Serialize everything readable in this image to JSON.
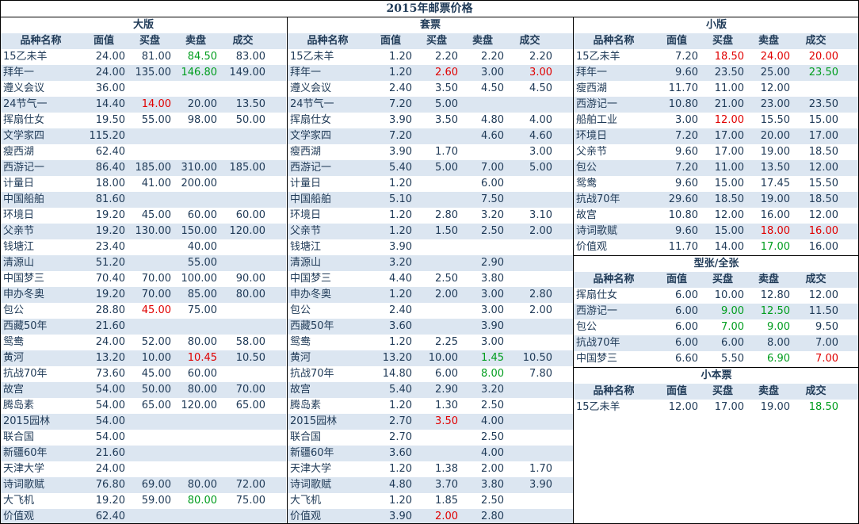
{
  "title": "2015年邮票价格",
  "headers": [
    "品种名称",
    "面值",
    "买盘",
    "卖盘",
    "成交"
  ],
  "colors": {
    "red": "#e00000",
    "green": "#009d1e",
    "shade": "#dce6f1",
    "text": "#1f3a57"
  },
  "sections": [
    {
      "id": "large",
      "title": "大版",
      "rows": [
        {
          "name": "15乙未羊",
          "face": "24.00",
          "bid": "81.00",
          "ask": "84.50",
          "deal": "83.00",
          "colors": {
            "ask": "green"
          }
        },
        {
          "name": "拜年一",
          "face": "24.00",
          "bid": "135.00",
          "ask": "146.80",
          "deal": "149.00",
          "colors": {
            "ask": "green"
          }
        },
        {
          "name": "遵义会议",
          "face": "36.00",
          "bid": "",
          "ask": "",
          "deal": ""
        },
        {
          "name": "24节气一",
          "face": "14.40",
          "bid": "14.00",
          "ask": "20.00",
          "deal": "13.50",
          "colors": {
            "bid": "red"
          }
        },
        {
          "name": "挥扇仕女",
          "face": "19.50",
          "bid": "55.00",
          "ask": "98.00",
          "deal": "50.00"
        },
        {
          "name": "文学家四",
          "face": "115.20",
          "bid": "",
          "ask": "",
          "deal": ""
        },
        {
          "name": "瘦西湖",
          "face": "62.40",
          "bid": "",
          "ask": "",
          "deal": ""
        },
        {
          "name": "西游记一",
          "face": "86.40",
          "bid": "185.00",
          "ask": "310.00",
          "deal": "185.00"
        },
        {
          "name": "计量日",
          "face": "18.00",
          "bid": "41.00",
          "ask": "200.00",
          "deal": ""
        },
        {
          "name": "中国船舶",
          "face": "81.60",
          "bid": "",
          "ask": "",
          "deal": ""
        },
        {
          "name": "环境日",
          "face": "19.20",
          "bid": "45.00",
          "ask": "60.00",
          "deal": "60.00"
        },
        {
          "name": "父亲节",
          "face": "19.20",
          "bid": "130.00",
          "ask": "150.00",
          "deal": "120.00"
        },
        {
          "name": "钱塘江",
          "face": "23.40",
          "bid": "",
          "ask": "40.00",
          "deal": ""
        },
        {
          "name": "清源山",
          "face": "51.20",
          "bid": "",
          "ask": "55.00",
          "deal": ""
        },
        {
          "name": "中国梦三",
          "face": "70.40",
          "bid": "70.00",
          "ask": "100.00",
          "deal": "90.00"
        },
        {
          "name": "申办冬奥",
          "face": "19.20",
          "bid": "70.00",
          "ask": "85.00",
          "deal": "80.00"
        },
        {
          "name": "包公",
          "face": "28.80",
          "bid": "45.00",
          "ask": "75.00",
          "deal": "",
          "colors": {
            "bid": "red"
          }
        },
        {
          "name": "西藏50年",
          "face": "21.60",
          "bid": "",
          "ask": "",
          "deal": ""
        },
        {
          "name": "鸳鸯",
          "face": "24.00",
          "bid": "52.00",
          "ask": "80.00",
          "deal": "58.00"
        },
        {
          "name": "黄河",
          "face": "13.20",
          "bid": "10.00",
          "ask": "10.45",
          "deal": "10.50",
          "colors": {
            "ask": "red"
          }
        },
        {
          "name": "抗战70年",
          "face": "73.60",
          "bid": "45.00",
          "ask": "60.00",
          "deal": ""
        },
        {
          "name": "故宫",
          "face": "54.00",
          "bid": "50.00",
          "ask": "80.00",
          "deal": "70.00"
        },
        {
          "name": "腾岛素",
          "face": "54.00",
          "bid": "65.00",
          "ask": "120.00",
          "deal": "65.00"
        },
        {
          "name": "2015园林",
          "face": "54.00",
          "bid": "",
          "ask": "",
          "deal": ""
        },
        {
          "name": "联合国",
          "face": "54.00",
          "bid": "",
          "ask": "",
          "deal": ""
        },
        {
          "name": "新疆60年",
          "face": "21.60",
          "bid": "",
          "ask": "",
          "deal": ""
        },
        {
          "name": "天津大学",
          "face": "24.00",
          "bid": "",
          "ask": "",
          "deal": ""
        },
        {
          "name": "诗词歌赋",
          "face": "76.80",
          "bid": "69.00",
          "ask": "80.00",
          "deal": "72.00"
        },
        {
          "name": "大飞机",
          "face": "19.20",
          "bid": "59.00",
          "ask": "80.00",
          "deal": "75.00",
          "colors": {
            "ask": "green"
          }
        },
        {
          "name": "价值观",
          "face": "62.40",
          "bid": "",
          "ask": "",
          "deal": ""
        }
      ]
    },
    {
      "id": "set",
      "title": "套票",
      "rows": [
        {
          "name": "15乙未羊",
          "face": "1.20",
          "bid": "2.20",
          "ask": "2.20",
          "deal": "2.20"
        },
        {
          "name": "拜年一",
          "face": "1.20",
          "bid": "2.60",
          "ask": "3.00",
          "deal": "3.00",
          "colors": {
            "bid": "red",
            "deal": "red"
          }
        },
        {
          "name": "遵义会议",
          "face": "2.40",
          "bid": "3.50",
          "ask": "4.50",
          "deal": "4.50"
        },
        {
          "name": "24节气一",
          "face": "7.20",
          "bid": "5.00",
          "ask": "",
          "deal": ""
        },
        {
          "name": "挥扇仕女",
          "face": "3.90",
          "bid": "3.50",
          "ask": "4.80",
          "deal": "4.00"
        },
        {
          "name": "文学家四",
          "face": "7.20",
          "bid": "",
          "ask": "4.60",
          "deal": "4.60"
        },
        {
          "name": "瘦西湖",
          "face": "3.90",
          "bid": "1.70",
          "ask": "",
          "deal": "3.00"
        },
        {
          "name": "西游记一",
          "face": "5.40",
          "bid": "5.00",
          "ask": "7.00",
          "deal": "5.00"
        },
        {
          "name": "计量日",
          "face": "1.20",
          "bid": "",
          "ask": "6.00",
          "deal": ""
        },
        {
          "name": "中国船舶",
          "face": "5.10",
          "bid": "",
          "ask": "7.50",
          "deal": ""
        },
        {
          "name": "环境日",
          "face": "1.20",
          "bid": "2.80",
          "ask": "3.20",
          "deal": "3.10"
        },
        {
          "name": "父亲节",
          "face": "1.20",
          "bid": "1.50",
          "ask": "2.50",
          "deal": "2.00"
        },
        {
          "name": "钱塘江",
          "face": "3.90",
          "bid": "",
          "ask": "",
          "deal": ""
        },
        {
          "name": "清源山",
          "face": "3.20",
          "bid": "",
          "ask": "2.90",
          "deal": ""
        },
        {
          "name": "中国梦三",
          "face": "4.40",
          "bid": "2.50",
          "ask": "3.80",
          "deal": ""
        },
        {
          "name": "申办冬奥",
          "face": "1.20",
          "bid": "2.00",
          "ask": "3.00",
          "deal": "2.80"
        },
        {
          "name": "包公",
          "face": "2.40",
          "bid": "",
          "ask": "3.00",
          "deal": "2.00"
        },
        {
          "name": "西藏50年",
          "face": "3.60",
          "bid": "",
          "ask": "3.90",
          "deal": ""
        },
        {
          "name": "鸳鸯",
          "face": "1.20",
          "bid": "2.25",
          "ask": "3.00",
          "deal": ""
        },
        {
          "name": "黄河",
          "face": "13.20",
          "bid": "10.00",
          "ask": "1.45",
          "deal": "10.50",
          "colors": {
            "ask": "green"
          }
        },
        {
          "name": "抗战70年",
          "face": "14.80",
          "bid": "6.00",
          "ask": "8.00",
          "deal": "7.80",
          "colors": {
            "ask": "green"
          }
        },
        {
          "name": "故宫",
          "face": "5.40",
          "bid": "2.90",
          "ask": "3.20",
          "deal": ""
        },
        {
          "name": "腾岛素",
          "face": "1.20",
          "bid": "1.30",
          "ask": "2.50",
          "deal": ""
        },
        {
          "name": "2015园林",
          "face": "2.70",
          "bid": "3.50",
          "ask": "4.00",
          "deal": "",
          "colors": {
            "bid": "red"
          }
        },
        {
          "name": "联合国",
          "face": "2.70",
          "bid": "",
          "ask": "2.50",
          "deal": ""
        },
        {
          "name": "新疆60年",
          "face": "3.60",
          "bid": "",
          "ask": "4.00",
          "deal": ""
        },
        {
          "name": "天津大学",
          "face": "1.20",
          "bid": "1.38",
          "ask": "2.00",
          "deal": "1.70"
        },
        {
          "name": "诗词歌赋",
          "face": "4.80",
          "bid": "3.70",
          "ask": "3.80",
          "deal": "3.90"
        },
        {
          "name": "大飞机",
          "face": "1.20",
          "bid": "1.85",
          "ask": "2.50",
          "deal": ""
        },
        {
          "name": "价值观",
          "face": "3.90",
          "bid": "2.00",
          "ask": "2.80",
          "deal": "",
          "colors": {
            "bid": "red"
          }
        }
      ]
    },
    {
      "id": "small",
      "title": "小版",
      "rows": [
        {
          "name": "15乙未羊",
          "face": "7.20",
          "bid": "18.50",
          "ask": "24.00",
          "deal": "20.00",
          "colors": {
            "bid": "red",
            "ask": "red",
            "deal": "red"
          }
        },
        {
          "name": "拜年一",
          "face": "9.60",
          "bid": "23.50",
          "ask": "25.00",
          "deal": "23.50",
          "colors": {
            "deal": "green"
          }
        },
        {
          "name": "瘦西湖",
          "face": "11.70",
          "bid": "11.00",
          "ask": "12.00",
          "deal": ""
        },
        {
          "name": "西游记一",
          "face": "10.80",
          "bid": "21.00",
          "ask": "23.00",
          "deal": "23.50"
        },
        {
          "name": "船舶工业",
          "face": "3.00",
          "bid": "12.00",
          "ask": "15.50",
          "deal": "15.00",
          "colors": {
            "bid": "red"
          }
        },
        {
          "name": "环境日",
          "face": "7.20",
          "bid": "17.00",
          "ask": "20.00",
          "deal": "17.00"
        },
        {
          "name": "父亲节",
          "face": "9.60",
          "bid": "17.00",
          "ask": "19.00",
          "deal": "18.50"
        },
        {
          "name": "包公",
          "face": "7.20",
          "bid": "11.00",
          "ask": "13.50",
          "deal": "12.00"
        },
        {
          "name": "鸳鸯",
          "face": "9.60",
          "bid": "15.00",
          "ask": "17.45",
          "deal": "15.50"
        },
        {
          "name": "抗战70年",
          "face": "29.60",
          "bid": "18.50",
          "ask": "19.00",
          "deal": "18.50"
        },
        {
          "name": "故宫",
          "face": "10.80",
          "bid": "12.00",
          "ask": "16.00",
          "deal": "12.00"
        },
        {
          "name": "诗词歌赋",
          "face": "9.60",
          "bid": "15.00",
          "ask": "18.00",
          "deal": "16.00",
          "colors": {
            "ask": "red",
            "deal": "red"
          }
        },
        {
          "name": "价值观",
          "face": "11.70",
          "bid": "14.00",
          "ask": "17.00",
          "deal": "16.00",
          "colors": {
            "ask": "green"
          }
        }
      ]
    },
    {
      "id": "type",
      "title": "型张/全张",
      "rows": [
        {
          "name": "挥扇仕女",
          "face": "6.00",
          "bid": "10.00",
          "ask": "12.80",
          "deal": "12.00"
        },
        {
          "name": "西游记一",
          "face": "6.00",
          "bid": "9.00",
          "ask": "12.50",
          "deal": "11.50",
          "colors": {
            "bid": "green",
            "ask": "green"
          }
        },
        {
          "name": "包公",
          "face": "6.00",
          "bid": "7.00",
          "ask": "9.00",
          "deal": "9.50",
          "colors": {
            "bid": "green",
            "ask": "green"
          }
        },
        {
          "name": "抗战70年",
          "face": "6.00",
          "bid": "6.00",
          "ask": "8.00",
          "deal": "7.00"
        },
        {
          "name": "中国梦三",
          "face": "6.60",
          "bid": "5.50",
          "ask": "6.90",
          "deal": "7.00",
          "colors": {
            "ask": "green",
            "deal": "red"
          }
        }
      ]
    },
    {
      "id": "booklet",
      "title": "小本票",
      "rows": [
        {
          "name": "15乙未羊",
          "face": "12.00",
          "bid": "17.00",
          "ask": "19.00",
          "deal": "18.50",
          "colors": {
            "deal": "green"
          }
        }
      ]
    }
  ]
}
